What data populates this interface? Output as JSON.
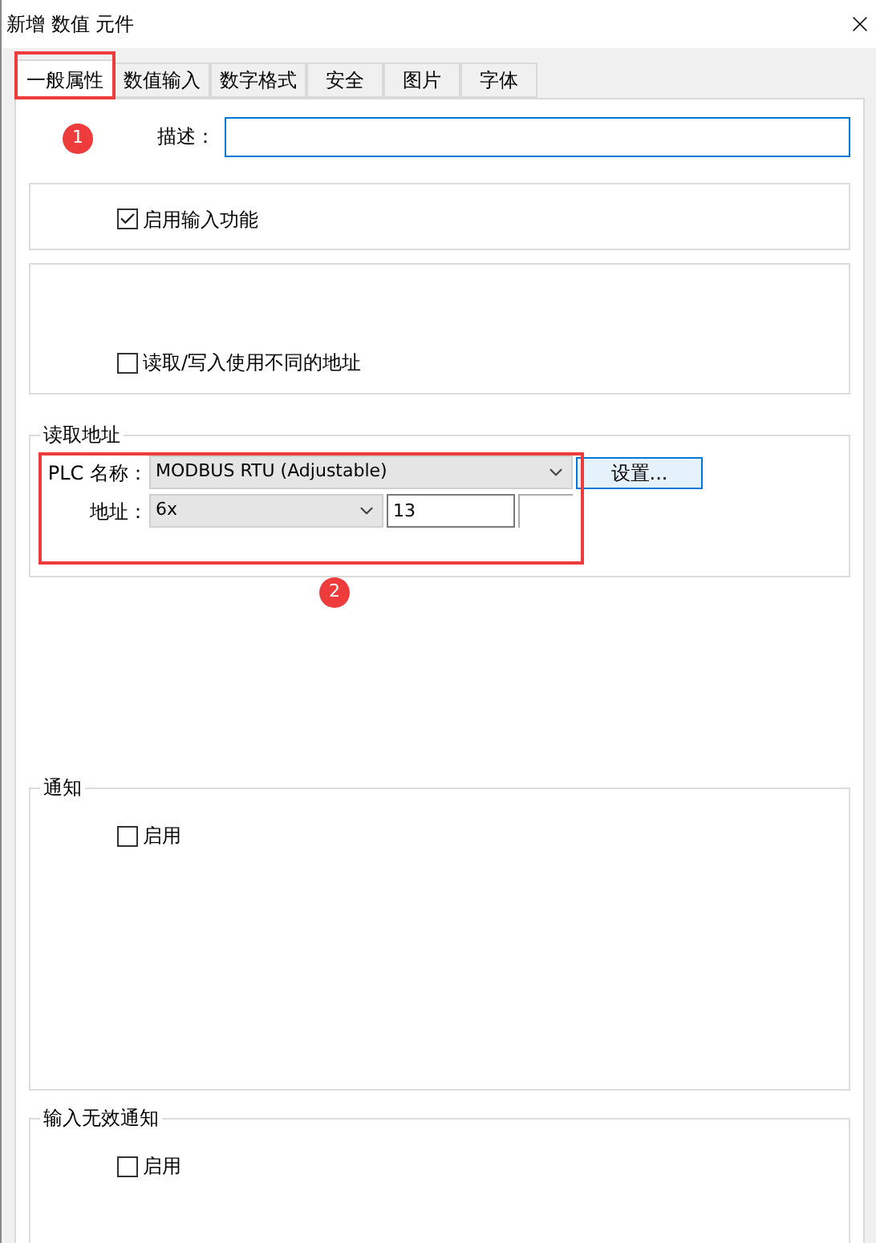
{
  "window": {
    "title": "新增 数值 元件"
  },
  "tabs": [
    {
      "label": "一般属性",
      "selected": true
    },
    {
      "label": "数值输入",
      "selected": false
    },
    {
      "label": "数字格式",
      "selected": false
    },
    {
      "label": "安全",
      "selected": false
    },
    {
      "label": "图片",
      "selected": false
    },
    {
      "label": "字体",
      "selected": false
    }
  ],
  "description": {
    "label": "描述："
  },
  "enable_input": {
    "label": "启用输入功能",
    "checked": true
  },
  "separate_address": {
    "label": "读取/写入使用不同的地址",
    "checked": false
  },
  "read_address": {
    "legend": "读取地址",
    "plc_label": "PLC 名称：",
    "plc_value": "MODBUS RTU (Adjustable)",
    "settings_button": "设置...",
    "address_label": "地址：",
    "device_type": "6x",
    "address_value": "13"
  },
  "notify": {
    "legend": "通知",
    "label": "启用",
    "checked": false
  },
  "invalid_notify": {
    "legend": "输入无效通知",
    "label": "启用",
    "checked": false
  },
  "annotations": [
    {
      "label": "1"
    },
    {
      "label": "2"
    }
  ]
}
